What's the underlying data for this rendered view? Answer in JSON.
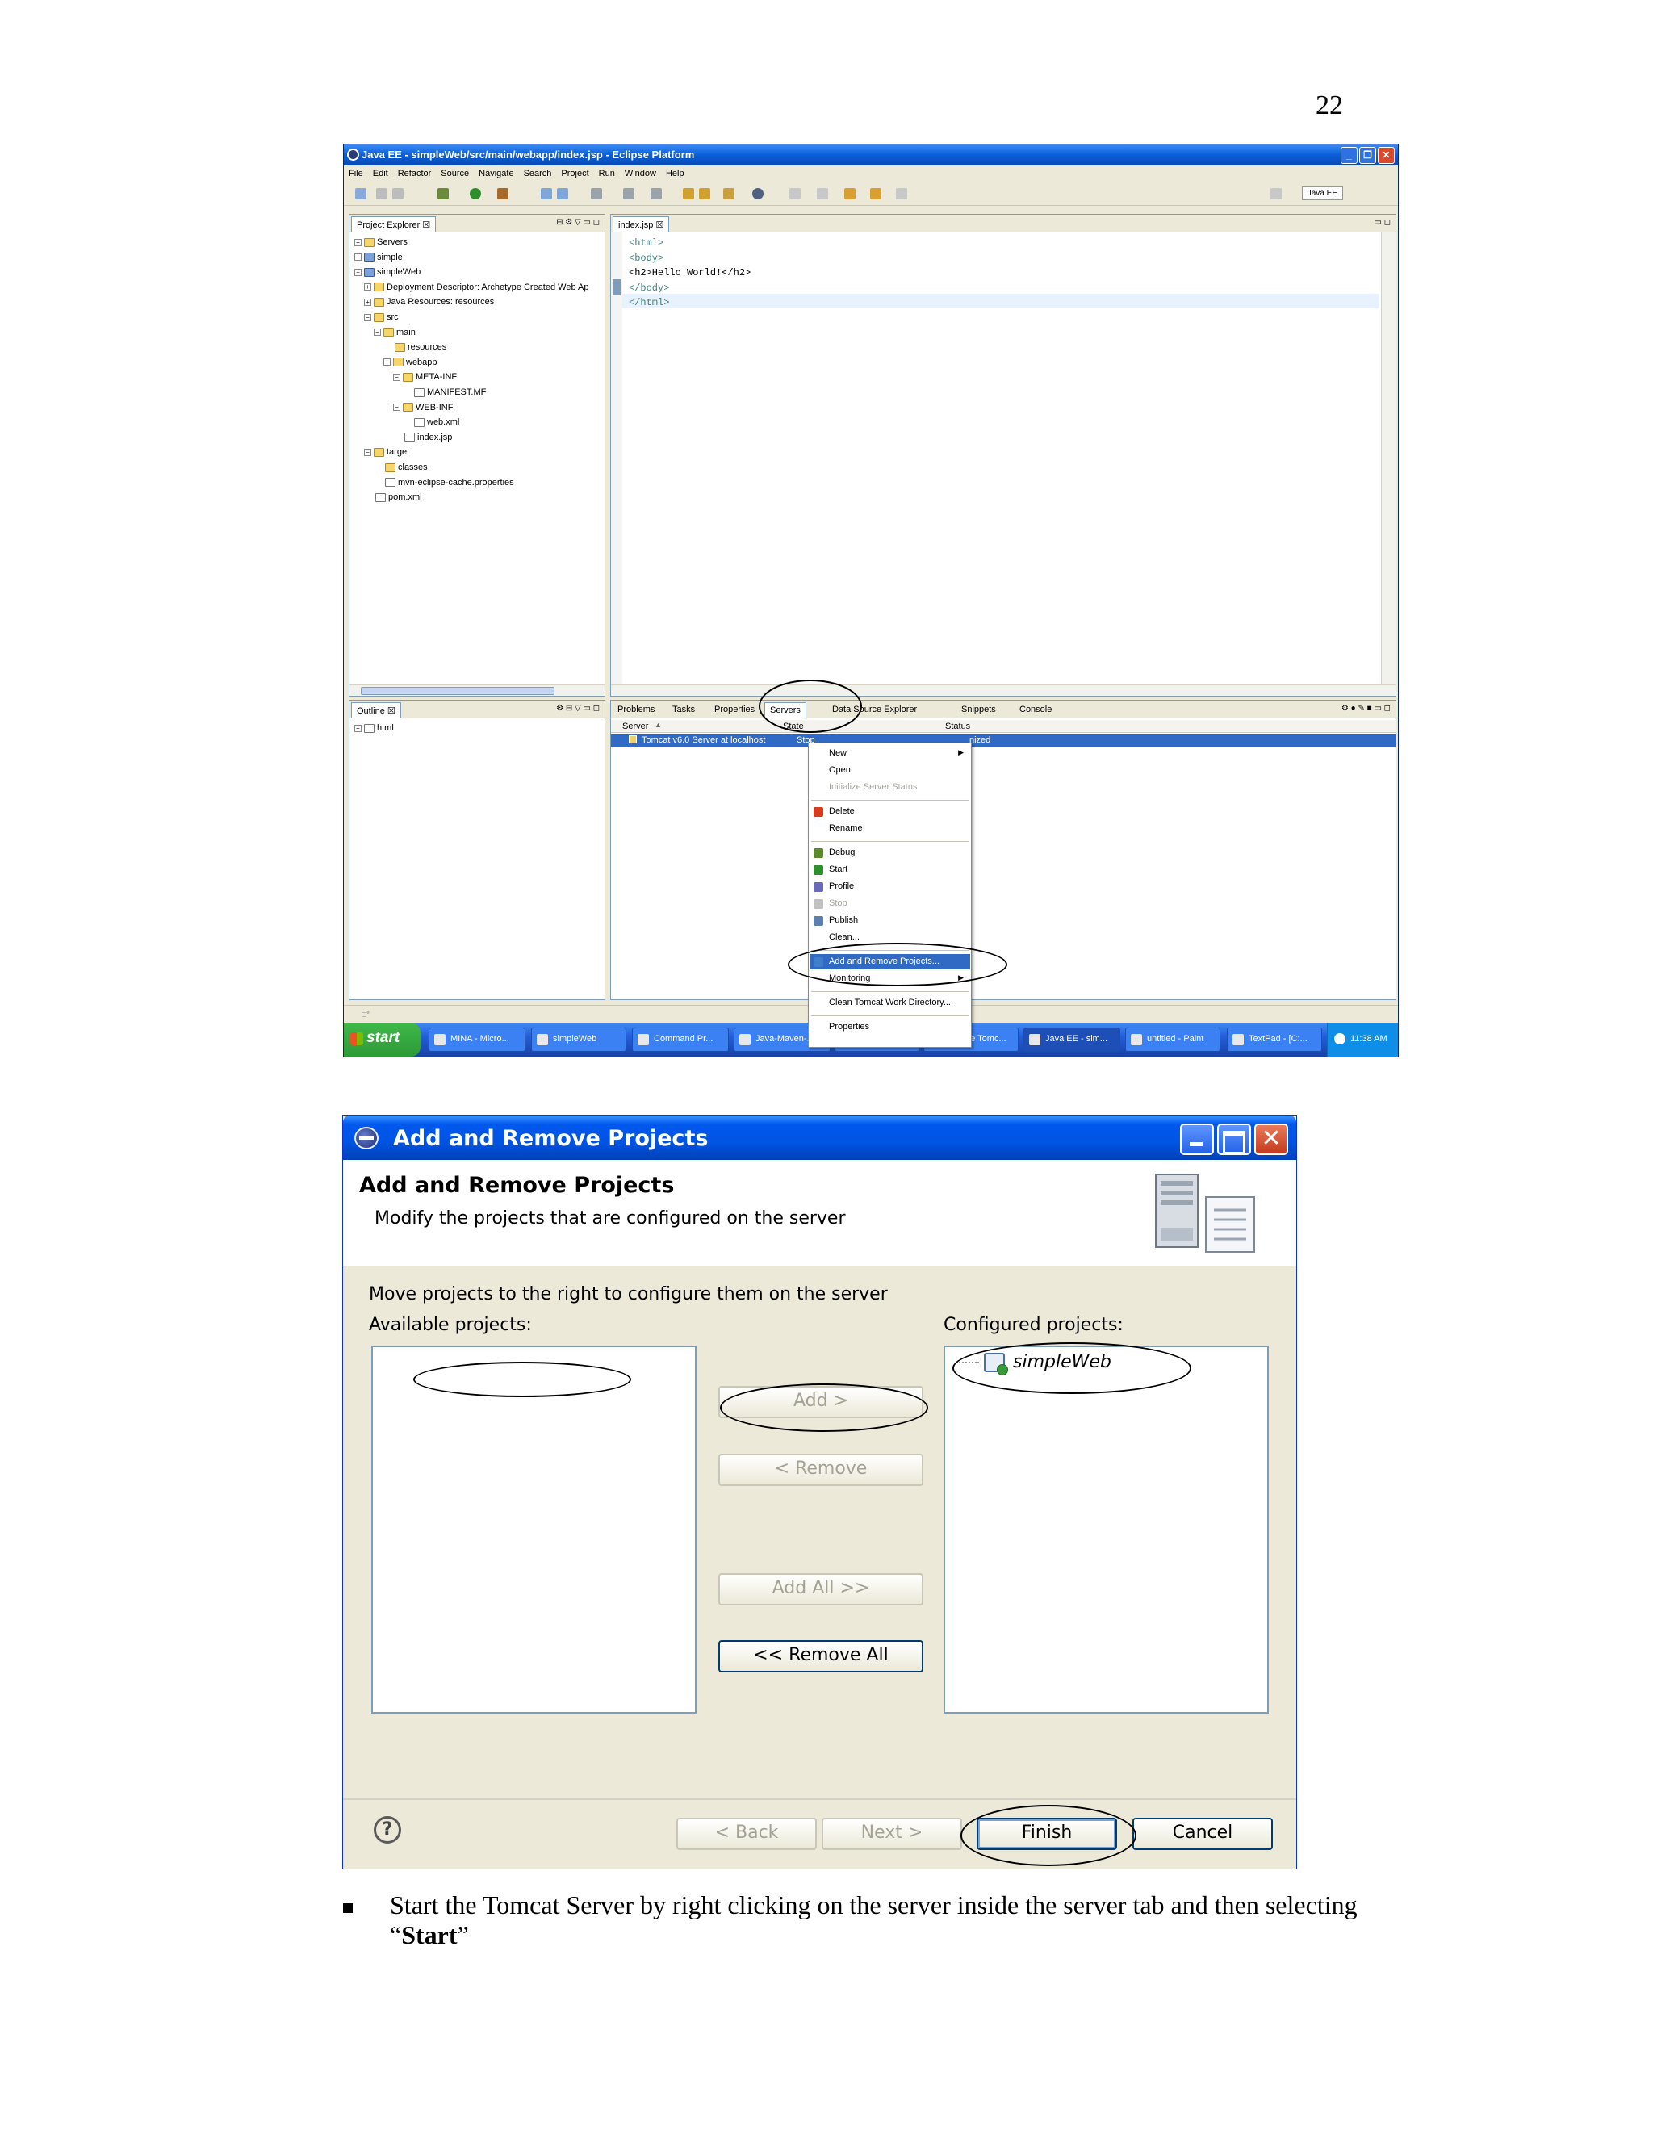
{
  "page": {
    "number": "22"
  },
  "eclipse": {
    "title": "Java EE - simpleWeb/src/main/webapp/index.jsp - Eclipse Platform",
    "menu": [
      "File",
      "Edit",
      "Refactor",
      "Source",
      "Navigate",
      "Search",
      "Project",
      "Run",
      "Window",
      "Help"
    ],
    "perspective": "Java EE",
    "project_explorer": {
      "tab": "Project Explorer",
      "tree": [
        {
          "label": "Servers",
          "depth": 0,
          "exp": "+",
          "icon": "folder"
        },
        {
          "label": "simple",
          "depth": 0,
          "exp": "+",
          "icon": "proj"
        },
        {
          "label": "simpleWeb",
          "depth": 0,
          "exp": "-",
          "icon": "proj"
        },
        {
          "label": "Deployment Descriptor: Archetype Created Web Ap",
          "depth": 1,
          "exp": "+",
          "icon": "folder"
        },
        {
          "label": "Java Resources: resources",
          "depth": 1,
          "exp": "+",
          "icon": "folder"
        },
        {
          "label": "src",
          "depth": 1,
          "exp": "-",
          "icon": "folder"
        },
        {
          "label": "main",
          "depth": 2,
          "exp": "-",
          "icon": "folder"
        },
        {
          "label": "resources",
          "depth": 3,
          "exp": "",
          "icon": "folder"
        },
        {
          "label": "webapp",
          "depth": 3,
          "exp": "-",
          "icon": "folder"
        },
        {
          "label": "META-INF",
          "depth": 4,
          "exp": "-",
          "icon": "folder"
        },
        {
          "label": "MANIFEST.MF",
          "depth": 5,
          "exp": "",
          "icon": "file"
        },
        {
          "label": "WEB-INF",
          "depth": 4,
          "exp": "-",
          "icon": "folder"
        },
        {
          "label": "web.xml",
          "depth": 5,
          "exp": "",
          "icon": "file"
        },
        {
          "label": "index.jsp",
          "depth": 4,
          "exp": "",
          "icon": "file"
        },
        {
          "label": "target",
          "depth": 1,
          "exp": "-",
          "icon": "folder"
        },
        {
          "label": "classes",
          "depth": 2,
          "exp": "",
          "icon": "folder"
        },
        {
          "label": "mvn-eclipse-cache.properties",
          "depth": 2,
          "exp": "",
          "icon": "file"
        },
        {
          "label": "pom.xml",
          "depth": 1,
          "exp": "",
          "icon": "file"
        }
      ]
    },
    "editor": {
      "tab": "index.jsp",
      "lines": [
        "<html>",
        "<body>",
        "<h2>Hello World!</h2>",
        "</body>",
        "</html>"
      ]
    },
    "outline": {
      "tab": "Outline",
      "items": [
        "html"
      ]
    },
    "bottom_tabs": [
      "Problems",
      "Tasks",
      "Properties",
      "Servers",
      "Data Source Explorer",
      "Snippets",
      "Console"
    ],
    "servers": {
      "columns": [
        "Server",
        "State",
        "Status"
      ],
      "row": {
        "server": "Tomcat v6.0 Server at localhost",
        "state": "Stop",
        "status": "nized"
      }
    },
    "context_menu": [
      {
        "label": "New",
        "state": "normal",
        "submenu": true,
        "icon": ""
      },
      {
        "label": "Open",
        "state": "normal",
        "submenu": false,
        "icon": ""
      },
      {
        "label": "Initialize Server Status",
        "state": "disabled",
        "submenu": false,
        "icon": ""
      },
      {
        "sep": true
      },
      {
        "label": "Delete",
        "state": "normal",
        "submenu": false,
        "icon": "#d83b1e"
      },
      {
        "label": "Rename",
        "state": "normal",
        "submenu": false,
        "icon": ""
      },
      {
        "sep": true
      },
      {
        "label": "Debug",
        "state": "normal",
        "submenu": false,
        "icon": "#5a8a2a"
      },
      {
        "label": "Start",
        "state": "normal",
        "submenu": false,
        "icon": "#2f8f2f"
      },
      {
        "label": "Profile",
        "state": "normal",
        "submenu": false,
        "icon": "#6a6ab8"
      },
      {
        "label": "Stop",
        "state": "disabled",
        "submenu": false,
        "icon": "#c0c0c0"
      },
      {
        "label": "Publish",
        "state": "normal",
        "submenu": false,
        "icon": "#5d7fb0"
      },
      {
        "label": "Clean...",
        "state": "normal",
        "submenu": false,
        "icon": ""
      },
      {
        "sep": true
      },
      {
        "label": "Add and Remove Projects...",
        "state": "selected",
        "submenu": false,
        "icon": "#3f7fc8"
      },
      {
        "label": "Monitoring",
        "state": "normal",
        "submenu": true,
        "icon": ""
      },
      {
        "sep": true
      },
      {
        "label": "Clean Tomcat Work Directory...",
        "state": "normal",
        "submenu": false,
        "icon": ""
      },
      {
        "sep": true
      },
      {
        "label": "Properties",
        "state": "normal",
        "submenu": false,
        "icon": ""
      }
    ],
    "taskbar": {
      "start": "start",
      "items": [
        "MINA - Micro...",
        "simpleWeb",
        "Command Pr...",
        "Java-Maven-...",
        "",
        "Apache Tomc...",
        "Java EE - sim...",
        "untitled - Paint",
        "TextPad - [C:..."
      ],
      "clock": "11:38 AM"
    }
  },
  "dialog": {
    "title": "Add and Remove Projects",
    "header_title": "Add and Remove Projects",
    "header_desc": "Modify the projects that are configured on the server",
    "instruction": "Move projects to the right to configure them on the server",
    "available_label": "Available projects:",
    "configured_label": "Configured projects:",
    "configured_items": [
      "simpleWeb"
    ],
    "buttons": {
      "add": "Add >",
      "remove": "< Remove",
      "add_all": "Add All >>",
      "remove_all": "<< Remove All",
      "back": "< Back",
      "next": "Next >",
      "finish": "Finish",
      "cancel": "Cancel",
      "help": "?"
    }
  },
  "caption": {
    "text": "Start the Tomcat Server by right clicking on the server inside the server tab and then selecting “",
    "bold": "Start",
    "end": "”"
  }
}
